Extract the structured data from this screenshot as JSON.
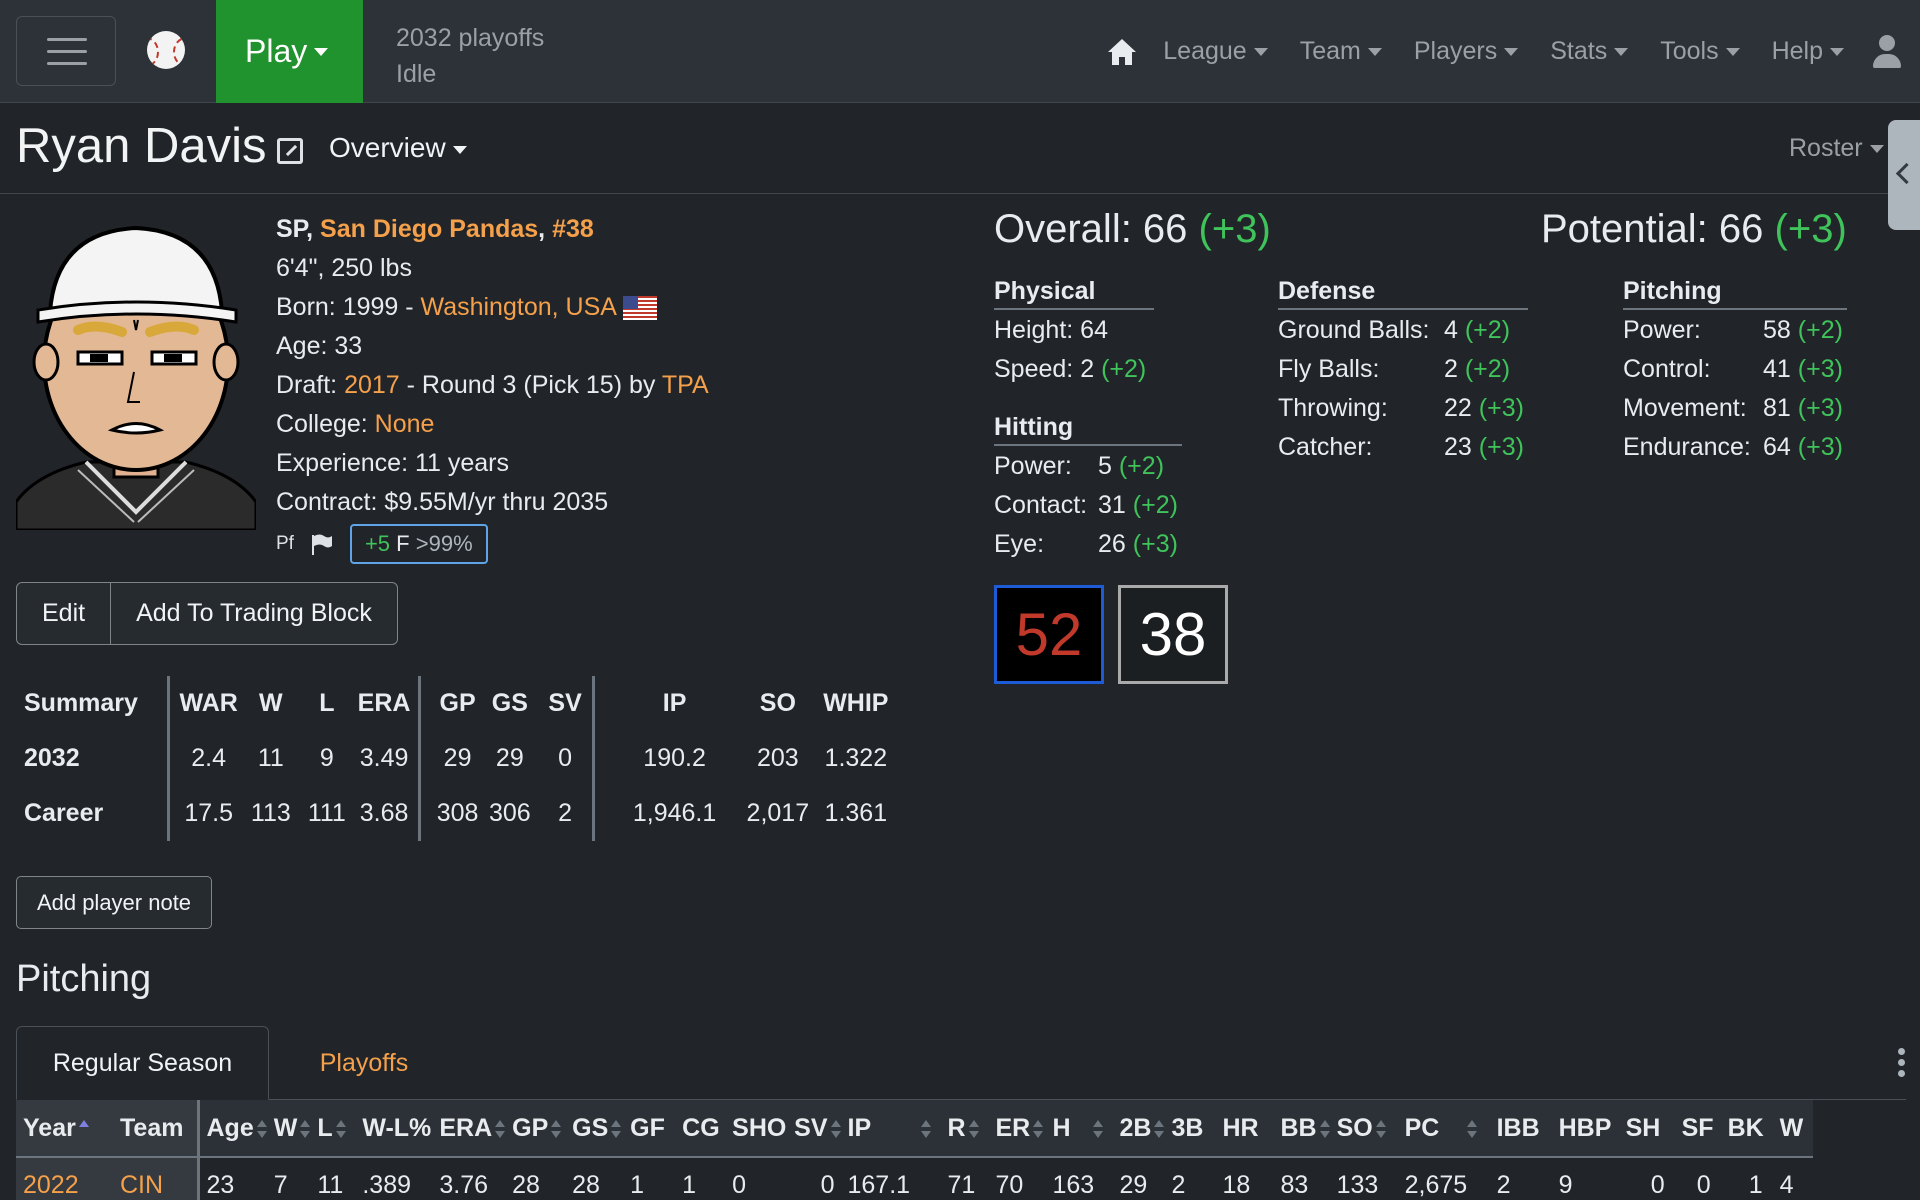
{
  "nav": {
    "play_label": "Play",
    "season": "2032 playoffs",
    "status": "Idle",
    "menu": [
      "League",
      "Team",
      "Players",
      "Stats",
      "Tools",
      "Help"
    ]
  },
  "header": {
    "player_name": "Ryan Davis",
    "view_dropdown": "Overview",
    "roster_link": "Roster"
  },
  "bio": {
    "position": "SP",
    "team": "San Diego Pandas",
    "jersey": "#38",
    "height_weight": "6'4\", 250 lbs",
    "born_label": "Born: 1999 - ",
    "born_place": "Washington, USA",
    "age": "Age: 33",
    "draft_label": "Draft: ",
    "draft_year": "2017",
    "draft_detail": " - Round 3 (Pick 15) by ",
    "draft_team": "TPA",
    "college_label": "College: ",
    "college": "None",
    "experience": "Experience: 11 years",
    "contract": "Contract: $9.55M/yr thru 2035",
    "pf_label": "Pf",
    "progs_delta": "+5",
    "progs_grade": "F",
    "progs_pct": ">99%"
  },
  "buttons": {
    "edit": "Edit",
    "trading_block": "Add To Trading Block",
    "player_note": "Add player note"
  },
  "summary": {
    "headers": [
      "Summary",
      "WAR",
      "W",
      "L",
      "ERA",
      "GP",
      "GS",
      "SV",
      "IP",
      "SO",
      "WHIP"
    ],
    "rows": [
      [
        "2032",
        "2.4",
        "11",
        "9",
        "3.49",
        "29",
        "29",
        "0",
        "190.2",
        "203",
        "1.322"
      ],
      [
        "Career",
        "17.5",
        "113",
        "111",
        "3.68",
        "308",
        "306",
        "2",
        "1,946.1",
        "2,017",
        "1.361"
      ]
    ]
  },
  "ratings": {
    "overall_label": "Overall: 66",
    "overall_delta": "(+3)",
    "potential_label": "Potential: 66",
    "potential_delta": "(+3)",
    "physical": {
      "title": "Physical",
      "rows": [
        {
          "label": "Height:",
          "value": "64",
          "delta": ""
        },
        {
          "label": "Speed:",
          "value": "2",
          "delta": "(+2)"
        }
      ]
    },
    "hitting": {
      "title": "Hitting",
      "rows": [
        {
          "label": "Power:",
          "value": "5",
          "delta": "(+2)"
        },
        {
          "label": "Contact:",
          "value": "31",
          "delta": "(+2)"
        },
        {
          "label": "Eye:",
          "value": "26",
          "delta": "(+3)"
        }
      ]
    },
    "defense": {
      "title": "Defense",
      "rows": [
        {
          "label": "Ground Balls:",
          "value": "4",
          "delta": "(+2)"
        },
        {
          "label": "Fly Balls:",
          "value": "2",
          "delta": "(+2)"
        },
        {
          "label": "Throwing:",
          "value": "22",
          "delta": "(+3)"
        },
        {
          "label": "Catcher:",
          "value": "23",
          "delta": "(+3)"
        }
      ]
    },
    "pitching": {
      "title": "Pitching",
      "rows": [
        {
          "label": "Power:",
          "value": "58",
          "delta": "(+2)"
        },
        {
          "label": "Control:",
          "value": "41",
          "delta": "(+3)"
        },
        {
          "label": "Movement:",
          "value": "81",
          "delta": "(+3)"
        },
        {
          "label": "Endurance:",
          "value": "64",
          "delta": "(+3)"
        }
      ]
    },
    "box_overall": "52",
    "box_potential": "38"
  },
  "pitching_section": {
    "title": "Pitching",
    "tabs": [
      "Regular Season",
      "Playoffs"
    ],
    "headers": [
      "Year",
      "Team",
      "Age",
      "W",
      "L",
      "W-L%",
      "ERA",
      "GP",
      "GS",
      "GF",
      "CG",
      "SHO",
      "SV",
      "IP",
      "R",
      "ER",
      "H",
      "2B",
      "3B",
      "HR",
      "BB",
      "SO",
      "PC",
      "IBB",
      "HBP",
      "SH",
      "SF",
      "BK",
      "W"
    ],
    "rows": [
      [
        "2022",
        "CIN",
        "23",
        "7",
        "11",
        ".389",
        "3.76",
        "28",
        "28",
        "1",
        "1",
        "0",
        "0",
        "167.1",
        "71",
        "70",
        "163",
        "29",
        "2",
        "18",
        "83",
        "133",
        "2,675",
        "2",
        "9",
        "0",
        "0",
        "1",
        "4"
      ]
    ]
  },
  "colors": {
    "accent_link": "#f5a04a",
    "positive_delta": "#3fc35a",
    "play_button": "#20922e"
  }
}
